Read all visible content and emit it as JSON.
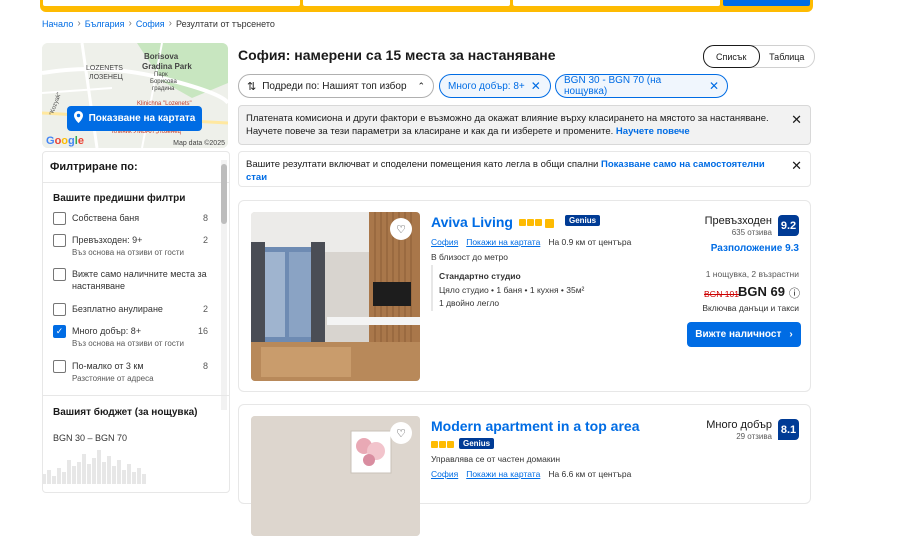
{
  "breadcrumb": [
    "Начало",
    "България",
    "София",
    "Резултати от търсенето"
  ],
  "map": {
    "labels": [
      "Borisova",
      "Gradina Park",
      "Парк",
      "Борисова",
      "градина",
      "LOZENETS",
      "ЛОЗЕНЕЦ",
      "\"Kozyak\"",
      "Клиник УМБАЛ „Лозенец“",
      "Klinichna \"Lozenets\""
    ],
    "show_btn": "Показване на картата",
    "google": "Google",
    "mapdata": "Map data ©2025"
  },
  "filters": {
    "title": "Филтриране по:",
    "prev_title": "Вашите предишни филтри",
    "items": [
      {
        "label": "Собствена баня",
        "sub": "",
        "count": "8",
        "checked": false
      },
      {
        "label": "Превъзходен: 9+",
        "sub": "Въз основа на отзиви от гости",
        "count": "2",
        "checked": false
      },
      {
        "label": "Вижте само наличните места за настаняване",
        "sub": "",
        "count": "",
        "checked": false
      },
      {
        "label": "Безплатно анулиране",
        "sub": "",
        "count": "2",
        "checked": false
      },
      {
        "label": "Много добър: 8+",
        "sub": "Въз основа на отзиви от гости",
        "count": "16",
        "checked": true
      },
      {
        "label": "По-малко от 3 км",
        "sub": "Разстояние от адреса",
        "count": "8",
        "checked": false
      }
    ],
    "budget_title": "Вашият бюджет (за нощувка)",
    "budget_range": "BGN 30 – BGN 70"
  },
  "main": {
    "title": "София: намерени са 15 места за настаняване",
    "view_list": "Списък",
    "view_table": "Таблица",
    "sort_label": "Подреди по: Нашият топ избор",
    "chip1": "Много добър: 8+",
    "chip2": "BGN 30 - BGN 70 (на нощувка)",
    "notice1": "Платената комисиона и други фактори е възможно да окажат влияние върху класирането на мястото за настаняване. Научете повече за тези параметри за класиране и как да ги изберете и промените.",
    "notice1_link": "Научете повече",
    "notice2": "Вашите резултати включват и споделени помещения като легла в общи спални",
    "notice2_link": "Показване само на самостоятелни стаи"
  },
  "cards": [
    {
      "name": "Aviva Living",
      "genius": "Genius",
      "city": "София",
      "map_link": "Покажи на картата",
      "distance": "На 0.9 км от центъра",
      "near": "В близост до метро",
      "room": "Стандартно студио",
      "room_desc": "Цяло студио • 1 баня • 1 кухня • 35м²",
      "bed": "1 двойно легло",
      "rating_word": "Превъзходен",
      "reviews": "635 отзива",
      "score": "9.2",
      "location_score": "Разположение 9.3",
      "nights": "1 нощувка, 2 възрастни",
      "old_price": "BGN 101",
      "price": "BGN 69",
      "taxes": "Включва данъци и такси",
      "cta": "Вижте наличност"
    },
    {
      "name": "Modern apartment in a top area",
      "genius": "Genius",
      "host": "Управлява се от частен домакин",
      "city": "София",
      "map_link": "Покажи на картата",
      "distance": "На 6.6 км от центъра",
      "rating_word": "Много добър",
      "reviews": "29 отзива",
      "score": "8.1"
    }
  ]
}
